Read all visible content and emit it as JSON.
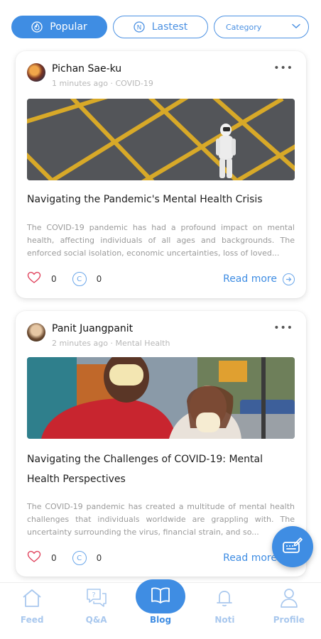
{
  "filters": {
    "popular_label": "Popular",
    "latest_label": "Lastest",
    "category_label": "Category"
  },
  "posts": [
    {
      "author": "Pichan Sae-ku",
      "meta": "1 minutes ago · COVID-19",
      "title": "Navigating the Pandemic's Mental Health Crisis",
      "excerpt": "The COVID-19 pandemic has had a profound impact on mental health, affecting individuals of all ages and backgrounds. The enforced social isolation, economic uncertainties, loss of loved...",
      "likes": "0",
      "comments": "0",
      "read_more": "Read more"
    },
    {
      "author": "Panit Juangpanit",
      "meta": "2 minutes ago · Mental Health",
      "title": "Navigating the Challenges of COVID-19: Mental Health Perspectives",
      "excerpt": "The COVID-19 pandemic has created a multitude of mental health challenges that individuals worldwide are grappling with. The uncertainty surrounding the virus, financial strain, and so...",
      "likes": "0",
      "comments": "0",
      "read_more": "Read more"
    }
  ],
  "comment_glyph": "C",
  "nav": {
    "items": [
      {
        "label": "Feed",
        "icon": "home-icon"
      },
      {
        "label": "Q&A",
        "icon": "question-chat-icon"
      },
      {
        "label": "Blog",
        "icon": "book-icon"
      },
      {
        "label": "Noti",
        "icon": "bell-icon"
      },
      {
        "label": "Profile",
        "icon": "user-icon"
      }
    ],
    "active": "Blog"
  },
  "colors": {
    "accent": "#3f8de3",
    "inactive_nav": "#a9c8ee",
    "like_heart": "#e0445e",
    "meta_text": "#b7b7b7"
  }
}
